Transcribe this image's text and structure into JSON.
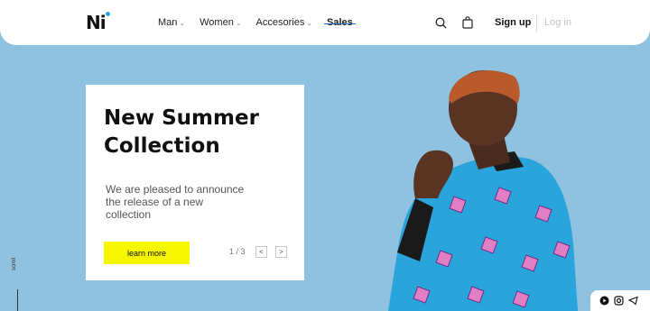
{
  "header": {
    "logo": "Ni",
    "nav": [
      {
        "label": "Man",
        "has_dropdown": true
      },
      {
        "label": "Women",
        "has_dropdown": true
      },
      {
        "label": "Accesories",
        "has_dropdown": true
      },
      {
        "label": "Sales",
        "has_dropdown": false
      }
    ],
    "signup": "Sign up",
    "login": "Log in"
  },
  "hero": {
    "title": "New Summer Collection",
    "description": "We are pleased to announce the release of a new collection",
    "cta": "learn more",
    "pager": "1 / 3"
  },
  "side": {
    "scroll_label": "scroll"
  },
  "icons": {
    "search": "search-icon",
    "bag": "shopping-bag-icon",
    "prev": "chevron-left-icon",
    "next": "chevron-right-icon",
    "social": [
      "youtube-icon",
      "instagram-icon",
      "telegram-icon"
    ]
  },
  "colors": {
    "background": "#8fc1e0",
    "accent": "#f6f600",
    "logo_dot": "#29a3ea"
  }
}
